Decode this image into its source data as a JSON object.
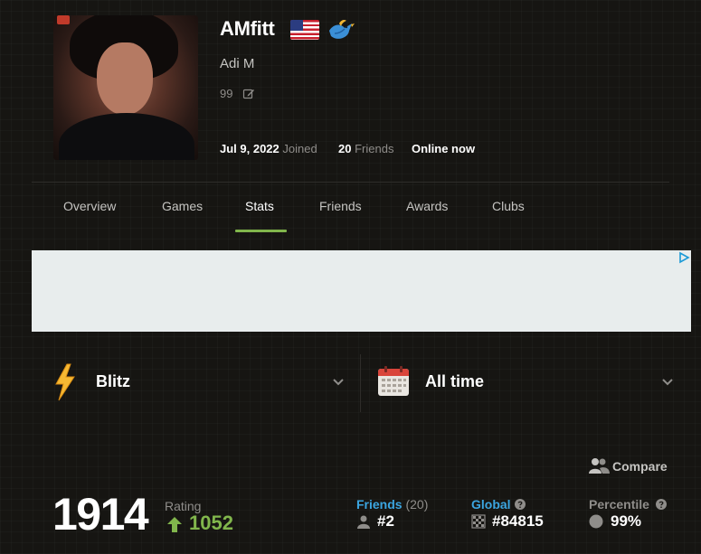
{
  "profile": {
    "username": "AMfitt",
    "real_name": "Adi M",
    "small_rating": "99",
    "joined_date": "Jul 9, 2022",
    "joined_label": "Joined",
    "friends_count": "20",
    "friends_label": "Friends",
    "status": "Online now"
  },
  "tabs": [
    {
      "label": "Overview"
    },
    {
      "label": "Games"
    },
    {
      "label": "Stats",
      "active": true
    },
    {
      "label": "Friends"
    },
    {
      "label": "Awards"
    },
    {
      "label": "Clubs"
    }
  ],
  "selectors": {
    "game_type": {
      "label": "Blitz",
      "icon": "lightning-bolt-icon"
    },
    "time_range": {
      "label": "All time",
      "icon": "calendar-icon"
    }
  },
  "compare": {
    "label": "Compare"
  },
  "stats": {
    "rating": "1914",
    "rating_caption": "Rating",
    "rating_change": "1052",
    "friends": {
      "label": "Friends",
      "count": "(20)",
      "value": "#2"
    },
    "global": {
      "label": "Global",
      "value": "#84815"
    },
    "percentile": {
      "label": "Percentile",
      "value": "99%"
    }
  },
  "colors": {
    "background": "#161512",
    "accent_green": "#81b64c",
    "link_blue": "#3ba5e0",
    "muted_text": "#8f8d8a"
  }
}
